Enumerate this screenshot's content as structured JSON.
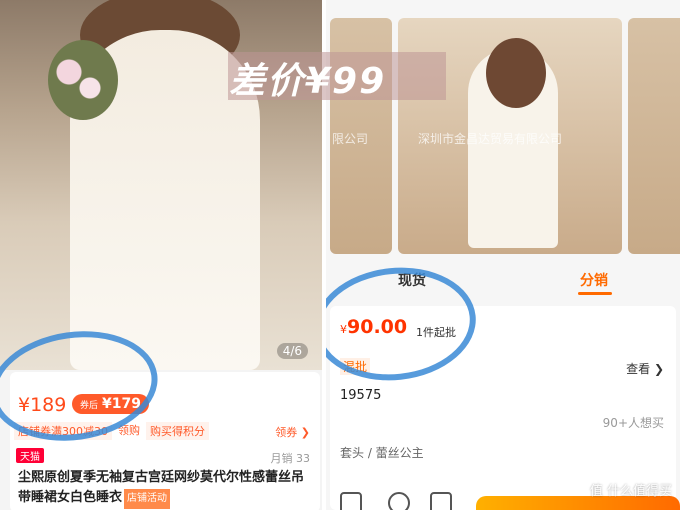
{
  "left": {
    "image_counter": "4/6",
    "price": "¥189",
    "coupon_price_tag": "券后",
    "coupon_price": "¥179",
    "promos": [
      "店铺券满300减30",
      "领购",
      "购买得积分"
    ],
    "coupon_link": "领券 ❯",
    "badge": "天猫",
    "monthly_sales": "月销 33",
    "title": "尘熙原创夏季无袖复古宫廷网纱莫代尔性感蕾丝吊带睡裙女白色睡衣",
    "shop_event": "店铺活动"
  },
  "right": {
    "banner": "差价¥99",
    "watermarks": [
      "限公司",
      "深圳市金昌达贸易有限公司"
    ],
    "tabs": [
      "现货",
      "分销"
    ],
    "price_currency": "¥",
    "price": "90.00",
    "moq": "1件起批",
    "mixed_batch": "混批",
    "view": "查看 ❯",
    "code": "19575",
    "wants": "90+人想买",
    "category": "套头 / 蕾丝公主",
    "credit": "值 什么值得买"
  },
  "colors": {
    "accent": "#ff6a00",
    "price_red": "#ff3300",
    "circle_blue": "#3a8ad6"
  }
}
